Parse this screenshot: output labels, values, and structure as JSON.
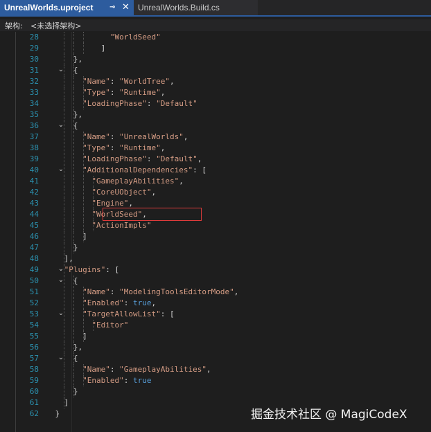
{
  "tabs": [
    {
      "title": "UnrealWorlds.uproject",
      "active": true,
      "pin_icon": "pin-icon",
      "close_icon": "close-icon"
    },
    {
      "title": "UnrealWorlds.Build.cs",
      "active": false
    }
  ],
  "nav": {
    "label": "架构:",
    "value": "<未选择架构>"
  },
  "code_lines": [
    {
      "n": "28",
      "fold": "",
      "guides": 3,
      "indent": 24,
      "tokens": [
        {
          "t": "\"WorldSeed\"",
          "c": "s"
        }
      ]
    },
    {
      "n": "29",
      "fold": "",
      "guides": 3,
      "indent": 22,
      "tokens": [
        {
          "t": "]",
          "c": "p"
        }
      ]
    },
    {
      "n": "30",
      "fold": "",
      "guides": 2,
      "indent": 16,
      "tokens": [
        {
          "t": "},",
          "c": "p"
        }
      ]
    },
    {
      "n": "31",
      "fold": "collapse",
      "guides": 2,
      "indent": 16,
      "tokens": [
        {
          "t": "{",
          "c": "p"
        }
      ]
    },
    {
      "n": "32",
      "fold": "",
      "guides": 3,
      "indent": 18,
      "tokens": [
        {
          "t": "\"Name\"",
          "c": "s"
        },
        {
          "t": ": ",
          "c": "p"
        },
        {
          "t": "\"WorldTree\"",
          "c": "s"
        },
        {
          "t": ",",
          "c": "p"
        }
      ]
    },
    {
      "n": "33",
      "fold": "",
      "guides": 3,
      "indent": 18,
      "tokens": [
        {
          "t": "\"Type\"",
          "c": "s"
        },
        {
          "t": ": ",
          "c": "p"
        },
        {
          "t": "\"Runtime\"",
          "c": "s"
        },
        {
          "t": ",",
          "c": "p"
        }
      ]
    },
    {
      "n": "34",
      "fold": "",
      "guides": 3,
      "indent": 18,
      "tokens": [
        {
          "t": "\"LoadingPhase\"",
          "c": "s"
        },
        {
          "t": ": ",
          "c": "p"
        },
        {
          "t": "\"Default\"",
          "c": "s"
        }
      ]
    },
    {
      "n": "35",
      "fold": "",
      "guides": 2,
      "indent": 16,
      "tokens": [
        {
          "t": "},",
          "c": "p"
        }
      ]
    },
    {
      "n": "36",
      "fold": "collapse",
      "guides": 2,
      "indent": 16,
      "tokens": [
        {
          "t": "{",
          "c": "p"
        }
      ]
    },
    {
      "n": "37",
      "fold": "",
      "guides": 3,
      "indent": 18,
      "tokens": [
        {
          "t": "\"Name\"",
          "c": "s"
        },
        {
          "t": ": ",
          "c": "p"
        },
        {
          "t": "\"UnrealWorlds\"",
          "c": "s"
        },
        {
          "t": ",",
          "c": "p"
        }
      ]
    },
    {
      "n": "38",
      "fold": "",
      "guides": 3,
      "indent": 18,
      "tokens": [
        {
          "t": "\"Type\"",
          "c": "s"
        },
        {
          "t": ": ",
          "c": "p"
        },
        {
          "t": "\"Runtime\"",
          "c": "s"
        },
        {
          "t": ",",
          "c": "p"
        }
      ]
    },
    {
      "n": "39",
      "fold": "",
      "guides": 3,
      "indent": 18,
      "tokens": [
        {
          "t": "\"LoadingPhase\"",
          "c": "s"
        },
        {
          "t": ": ",
          "c": "p"
        },
        {
          "t": "\"Default\"",
          "c": "s"
        },
        {
          "t": ",",
          "c": "p"
        }
      ]
    },
    {
      "n": "40",
      "fold": "collapse",
      "guides": 3,
      "indent": 18,
      "tokens": [
        {
          "t": "\"AdditionalDependencies\"",
          "c": "s"
        },
        {
          "t": ": [",
          "c": "p"
        }
      ]
    },
    {
      "n": "41",
      "fold": "",
      "guides": 4,
      "indent": 20,
      "tokens": [
        {
          "t": "\"GameplayAbilities\"",
          "c": "s"
        },
        {
          "t": ",",
          "c": "p"
        }
      ]
    },
    {
      "n": "42",
      "fold": "",
      "guides": 4,
      "indent": 20,
      "tokens": [
        {
          "t": "\"CoreUObject\"",
          "c": "s"
        },
        {
          "t": ",",
          "c": "p"
        }
      ]
    },
    {
      "n": "43",
      "fold": "",
      "guides": 4,
      "indent": 20,
      "tokens": [
        {
          "t": "\"Engine\"",
          "c": "s"
        },
        {
          "t": ",",
          "c": "p"
        }
      ]
    },
    {
      "n": "44",
      "fold": "",
      "guides": 4,
      "indent": 20,
      "tokens": [
        {
          "t": "\"WorldSeed\"",
          "c": "s"
        },
        {
          "t": ",",
          "c": "p"
        }
      ]
    },
    {
      "n": "45",
      "fold": "",
      "guides": 4,
      "indent": 20,
      "tokens": [
        {
          "t": "\"ActionImpls\"",
          "c": "s"
        }
      ]
    },
    {
      "n": "46",
      "fold": "",
      "guides": 3,
      "indent": 18,
      "tokens": [
        {
          "t": "]",
          "c": "p"
        }
      ]
    },
    {
      "n": "47",
      "fold": "",
      "guides": 2,
      "indent": 16,
      "tokens": [
        {
          "t": "}",
          "c": "p"
        }
      ]
    },
    {
      "n": "48",
      "fold": "",
      "guides": 1,
      "indent": 14,
      "tokens": [
        {
          "t": "],",
          "c": "p"
        }
      ]
    },
    {
      "n": "49",
      "fold": "collapse",
      "guides": 1,
      "indent": 14,
      "tokens": [
        {
          "t": "\"Plugins\"",
          "c": "s"
        },
        {
          "t": ": [",
          "c": "p"
        }
      ]
    },
    {
      "n": "50",
      "fold": "collapse",
      "guides": 2,
      "indent": 16,
      "tokens": [
        {
          "t": "{",
          "c": "p"
        }
      ]
    },
    {
      "n": "51",
      "fold": "",
      "guides": 3,
      "indent": 18,
      "tokens": [
        {
          "t": "\"Name\"",
          "c": "s"
        },
        {
          "t": ": ",
          "c": "p"
        },
        {
          "t": "\"ModelingToolsEditorMode\"",
          "c": "s"
        },
        {
          "t": ",",
          "c": "p"
        }
      ]
    },
    {
      "n": "52",
      "fold": "",
      "guides": 3,
      "indent": 18,
      "tokens": [
        {
          "t": "\"Enabled\"",
          "c": "s"
        },
        {
          "t": ": ",
          "c": "p"
        },
        {
          "t": "true",
          "c": "k"
        },
        {
          "t": ",",
          "c": "p"
        }
      ]
    },
    {
      "n": "53",
      "fold": "collapse",
      "guides": 3,
      "indent": 18,
      "tokens": [
        {
          "t": "\"TargetAllowList\"",
          "c": "s"
        },
        {
          "t": ": [",
          "c": "p"
        }
      ]
    },
    {
      "n": "54",
      "fold": "",
      "guides": 4,
      "indent": 20,
      "tokens": [
        {
          "t": "\"Editor\"",
          "c": "s"
        }
      ]
    },
    {
      "n": "55",
      "fold": "",
      "guides": 3,
      "indent": 18,
      "tokens": [
        {
          "t": "]",
          "c": "p"
        }
      ]
    },
    {
      "n": "56",
      "fold": "",
      "guides": 2,
      "indent": 16,
      "tokens": [
        {
          "t": "},",
          "c": "p"
        }
      ]
    },
    {
      "n": "57",
      "fold": "collapse",
      "guides": 2,
      "indent": 16,
      "tokens": [
        {
          "t": "{",
          "c": "p"
        }
      ]
    },
    {
      "n": "58",
      "fold": "",
      "guides": 3,
      "indent": 18,
      "tokens": [
        {
          "t": "\"Name\"",
          "c": "s"
        },
        {
          "t": ": ",
          "c": "p"
        },
        {
          "t": "\"GameplayAbilities\"",
          "c": "s"
        },
        {
          "t": ",",
          "c": "p"
        }
      ]
    },
    {
      "n": "59",
      "fold": "",
      "guides": 3,
      "indent": 18,
      "tokens": [
        {
          "t": "\"Enabled\"",
          "c": "s"
        },
        {
          "t": ": ",
          "c": "p"
        },
        {
          "t": "true",
          "c": "k"
        }
      ]
    },
    {
      "n": "60",
      "fold": "",
      "guides": 2,
      "indent": 16,
      "tokens": [
        {
          "t": "}",
          "c": "p"
        }
      ]
    },
    {
      "n": "61",
      "fold": "",
      "guides": 1,
      "indent": 14,
      "tokens": [
        {
          "t": "]",
          "c": "p"
        }
      ]
    },
    {
      "n": "62",
      "fold": "",
      "guides": 0,
      "indent": 12,
      "tokens": [
        {
          "t": "}",
          "c": "p"
        }
      ]
    }
  ],
  "highlight": {
    "line": "44",
    "color": "#e03b3b"
  },
  "colors": {
    "string": "#d69d85",
    "keyword": "#569cd6",
    "line_number": "#2b91af",
    "tab_active": "#2d5c9e"
  },
  "watermark": "掘金技术社区 @ MagiCodeX"
}
